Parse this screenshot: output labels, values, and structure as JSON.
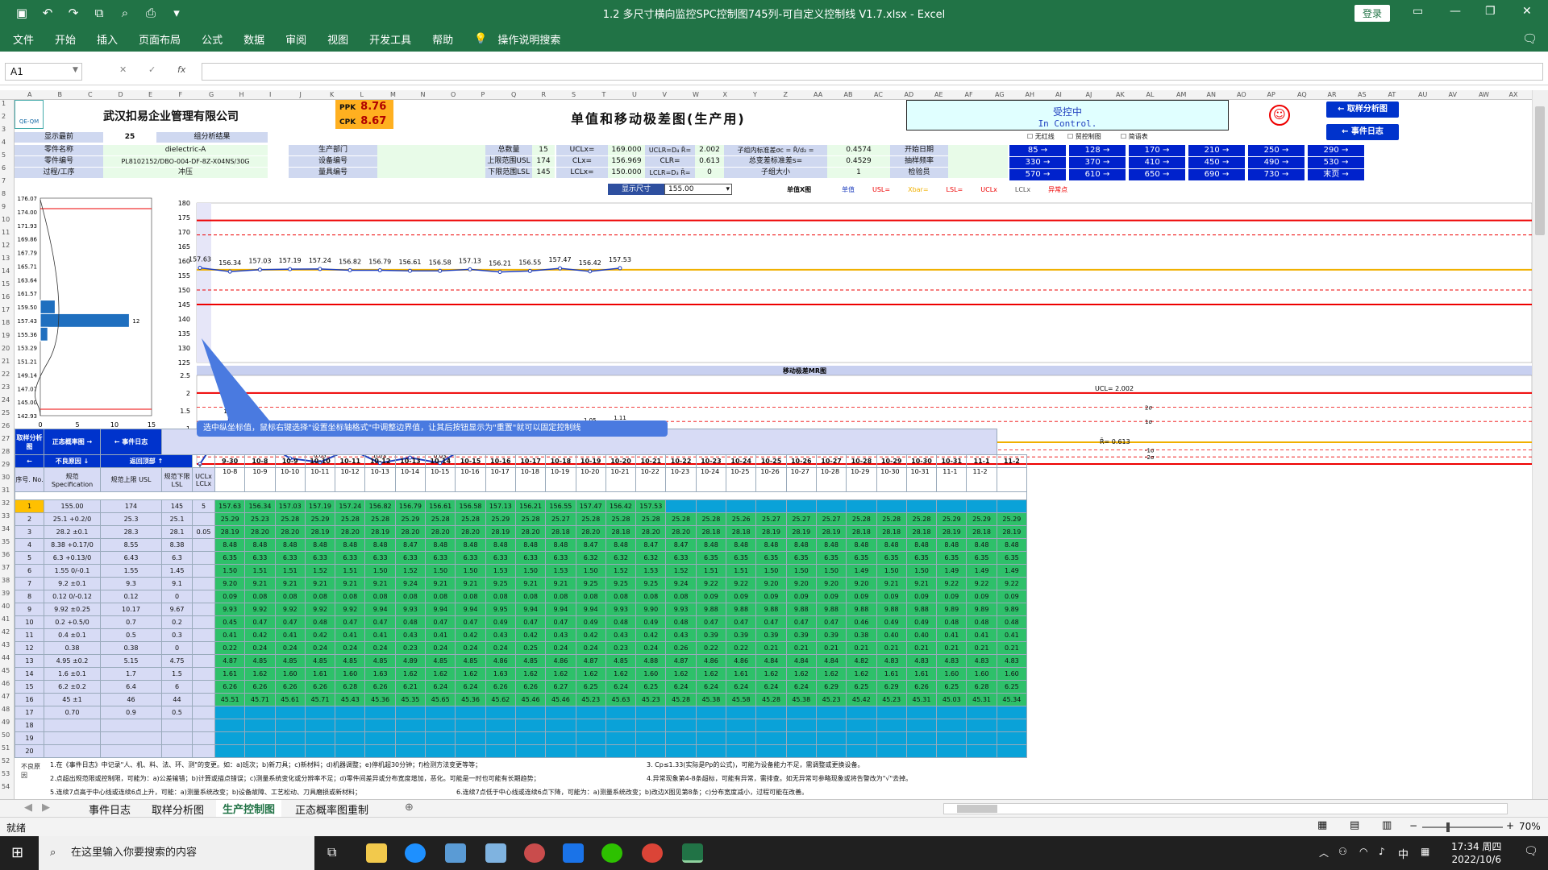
{
  "window": {
    "title": "1.2 多尺寸横向监控SPC控制图745列-可自定义控制线 V1.7.xlsx  -  Excel",
    "login": "登录"
  },
  "ribbon": [
    "文件",
    "开始",
    "插入",
    "页面布局",
    "公式",
    "数据",
    "审阅",
    "视图",
    "开发工具",
    "帮助",
    "操作说明搜索"
  ],
  "formula": {
    "namebox": "A1",
    "fx_label": "fx",
    "value": ""
  },
  "columns": [
    "A",
    "B",
    "C",
    "D",
    "E",
    "F",
    "G",
    "H",
    "I",
    "J",
    "K",
    "L",
    "M",
    "N",
    "O",
    "P",
    "Q",
    "R",
    "S",
    "T",
    "U",
    "V",
    "W",
    "X",
    "Y",
    "Z",
    "AA",
    "AB",
    "AC",
    "AD",
    "AE",
    "AF",
    "AG",
    "AH",
    "AI",
    "AJ",
    "AK",
    "AL",
    "AM",
    "AN",
    "AO",
    "AP",
    "AQ",
    "AR",
    "AS",
    "AT",
    "AU",
    "AV",
    "AW",
    "AX"
  ],
  "header": {
    "logo": "QE-QM",
    "company": "武汉扣易企业管理有限公司",
    "chart_title": "单值和移动极差图(生产用)",
    "ppk_label": "PPK",
    "ppk": "8.76",
    "cpk_label": "CPK",
    "cpk": "8.67",
    "status_cn": "受控中",
    "status_en": "In Control.",
    "btn_sampling": "← 取样分析图",
    "btn_events": "← 事件日志",
    "checkboxes": [
      "无红线",
      "贸控制图",
      "简语表"
    ]
  },
  "info": {
    "display_recent_label": "显示最前",
    "display_recent": "25",
    "group_result_label": "组分析结果",
    "part_name_label": "零件名称",
    "part_name": "dielectric-A",
    "part_no_label": "零件编号",
    "part_no": "PL8102152/DBO-004-DF-8Z-X04NS/30G",
    "process_label": "过程/工序",
    "process": "冲压",
    "dept_label": "生产部门",
    "equip_label": "设备编号",
    "tool_label": "量具编号",
    "total_label": "总数量",
    "total": "15",
    "usl_label": "上限范围USL",
    "usl": "174",
    "lsl_label": "下限范围LSL",
    "lsl": "145",
    "ucl_label": "UCLx=",
    "ucl": "169.000",
    "cl_label": "CLx=",
    "cl": "156.969",
    "lcl_label": "LCLx=",
    "lcl": "150.000",
    "uclr_label": "UCLR=D₄ R̄=",
    "uclr": "2.002",
    "clr_label": "CLR=",
    "clr": "0.613",
    "lclr_label": "LCLR=D₃ R̄=",
    "lclr": "0",
    "sigma_in_label": "子组内标准差σc = R̄/d₂ =",
    "sigma_in": "0.4574",
    "sigma_tot_label": "总变差标准差s=",
    "sigma_tot": "0.4529",
    "subgroup_label": "子组大小",
    "subgroup": "1",
    "start_label": "开始日期",
    "freq_label": "抽样频率",
    "inspector_label": "检验员",
    "pages": [
      "85 →",
      "128 →",
      "170 →",
      "210 →",
      "250 →",
      "290 →",
      "330 →",
      "370 →",
      "410 →",
      "450 →",
      "490 →",
      "530 →",
      "570 →",
      "610 →",
      "650 →",
      "690 →",
      "730 →",
      "末页 →"
    ],
    "display_size_label": "显示尺寸",
    "display_size": "155.00"
  },
  "chart_data": [
    {
      "type": "histogram",
      "title": "",
      "bins": [
        "176.07",
        "174.00",
        "171.93",
        "169.86",
        "167.79",
        "165.71",
        "163.64",
        "161.57",
        "159.50",
        "157.43",
        "155.36",
        "153.29",
        "151.21",
        "149.14",
        "147.07",
        "145.00",
        "142.93"
      ],
      "counts": [
        0,
        0,
        0,
        0,
        0,
        0,
        0,
        0,
        2,
        12,
        1,
        0,
        0,
        0,
        0,
        0,
        0
      ],
      "xticks": [
        "0",
        "5",
        "10",
        "15"
      ],
      "count_label": "12"
    },
    {
      "type": "line",
      "title": "单值X图",
      "legend": [
        "单值",
        "USL=",
        "Xbar=",
        "LSL=",
        "UCLx",
        "LCLx",
        "异常点"
      ],
      "categories": [
        "9-30",
        "10-8",
        "10-9",
        "10-10",
        "10-11",
        "10-12",
        "10-13",
        "10-14",
        "10-15",
        "10-16",
        "10-17",
        "10-18",
        "10-19",
        "10-20",
        "10-21",
        "10-22",
        "10-23",
        "10-24",
        "10-25",
        "10-26",
        "10-27",
        "10-28",
        "10-29",
        "10-30",
        "10-31",
        "11-1",
        "11-2"
      ],
      "values": [
        157.63,
        156.34,
        157.03,
        157.19,
        157.24,
        156.82,
        156.79,
        156.61,
        156.58,
        157.13,
        156.21,
        156.55,
        157.47,
        156.42,
        157.53
      ],
      "yticks": [
        "180",
        "175",
        "170",
        "165",
        "160",
        "155",
        "150",
        "145",
        "140",
        "135",
        "130",
        "125"
      ],
      "ylim": [
        125,
        180
      ],
      "usl": 174,
      "lsl": 145,
      "ucl": 169,
      "cl": 156.969,
      "lcl": 150
    },
    {
      "type": "line",
      "title": "移动极差MR图",
      "categories": [
        "9-30",
        "10-8",
        "10-9",
        "10-10",
        "10-11",
        "10-12",
        "10-13",
        "10-14",
        "10-15",
        "10-16",
        "10-17",
        "10-18",
        "10-19",
        "10-20",
        "10-21",
        "10-22",
        "10-23",
        "10-24",
        "10-25",
        "10-26",
        "10-27",
        "10-28",
        "10-29",
        "10-30",
        "10-31",
        "11-1",
        "11-2"
      ],
      "values": [
        0,
        1.29,
        0.69,
        0.16,
        0.05,
        0.42,
        0.03,
        0.18,
        0.03,
        0.55,
        0.92,
        0.34,
        0.92,
        1.05,
        1.11
      ],
      "yticks": [
        "2.5",
        "2",
        "1.5",
        "1",
        "0.5",
        "0"
      ],
      "ylim": [
        0,
        2.5
      ],
      "ucl": 2.002,
      "cl": 0.613,
      "ucl_label": "UCL= 2.002",
      "cl_label": "R̄= 0.613",
      "zone_labels": [
        "2σ",
        "1σ",
        "-1σ",
        "-2σ"
      ]
    }
  ],
  "tooltip": "选中纵坐标值，鼠标右键选择\"设置坐标轴格式\"中调整边界值，让其后按钮显示为\"重置\"就可以固定控制线",
  "table": {
    "left_btns": [
      "取样分析图",
      "正态概率图 →",
      "← 事件日志",
      "←",
      "不良原因 ↓",
      "返回顶部 ↑"
    ],
    "hdr": [
      "序号. No.",
      "规范 Specification",
      "规范上限 USL",
      "规范下限 LSL",
      "UCLx LCLx"
    ],
    "dates": [
      "9-30",
      "10-8",
      "10-9",
      "10-10",
      "10-11",
      "10-12",
      "10-13",
      "10-14",
      "10-15",
      "10-16",
      "10-17",
      "10-18",
      "10-19",
      "10-20",
      "10-21",
      "10-22",
      "10-23",
      "10-24",
      "10-25",
      "10-26",
      "10-27",
      "10-28",
      "10-29",
      "10-30",
      "10-31",
      "11-1",
      "11-2"
    ],
    "rows": [
      {
        "no": "1",
        "spec": "155.00",
        "usl": "174",
        "lsl": "145",
        "ctl": "5",
        "v": [
          "157.63",
          "156.34",
          "157.03",
          "157.19",
          "157.24",
          "156.82",
          "156.79",
          "156.61",
          "156.58",
          "157.13",
          "156.21",
          "156.55",
          "157.47",
          "156.42",
          "157.53"
        ]
      },
      {
        "no": "2",
        "spec": "25.1 +0.2/0",
        "usl": "25.3",
        "lsl": "25.1",
        "ctl": "",
        "v": [
          "25.29",
          "25.23",
          "25.28",
          "25.29",
          "25.28",
          "25.28",
          "25.29",
          "25.28",
          "25.28",
          "25.29",
          "25.28",
          "25.27",
          "25.28",
          "25.28",
          "25.28",
          "25.28",
          "25.28",
          "25.26",
          "25.27",
          "25.27",
          "25.27",
          "25.28",
          "25.28",
          "25.28",
          "25.29",
          "25.29",
          "25.29"
        ]
      },
      {
        "no": "3",
        "spec": "28.2 ±0.1",
        "usl": "28.3",
        "lsl": "28.1",
        "ctl": "0.05",
        "v": [
          "28.19",
          "28.20",
          "28.20",
          "28.19",
          "28.20",
          "28.19",
          "28.20",
          "28.20",
          "28.20",
          "28.19",
          "28.20",
          "28.18",
          "28.20",
          "28.18",
          "28.20",
          "28.20",
          "28.18",
          "28.18",
          "28.19",
          "28.19",
          "28.19",
          "28.18",
          "28.18",
          "28.18",
          "28.19",
          "28.18",
          "28.19"
        ]
      },
      {
        "no": "4",
        "spec": "8.38 +0.17/0",
        "usl": "8.55",
        "lsl": "8.38",
        "ctl": "",
        "v": [
          "8.48",
          "8.48",
          "8.48",
          "8.48",
          "8.48",
          "8.48",
          "8.47",
          "8.48",
          "8.48",
          "8.48",
          "8.48",
          "8.48",
          "8.47",
          "8.48",
          "8.47",
          "8.47",
          "8.48",
          "8.48",
          "8.48",
          "8.48",
          "8.48",
          "8.48",
          "8.48",
          "8.48",
          "8.48",
          "8.48",
          "8.48"
        ]
      },
      {
        "no": "5",
        "spec": "6.3 +0.13/0",
        "usl": "6.43",
        "lsl": "6.3",
        "ctl": "",
        "v": [
          "6.35",
          "6.33",
          "6.33",
          "6.33",
          "6.33",
          "6.33",
          "6.33",
          "6.33",
          "6.33",
          "6.33",
          "6.33",
          "6.33",
          "6.32",
          "6.32",
          "6.32",
          "6.33",
          "6.35",
          "6.35",
          "6.35",
          "6.35",
          "6.35",
          "6.35",
          "6.35",
          "6.35",
          "6.35",
          "6.35",
          "6.35"
        ]
      },
      {
        "no": "6",
        "spec": "1.55 0/-0.1",
        "usl": "1.55",
        "lsl": "1.45",
        "ctl": "",
        "v": [
          "1.50",
          "1.51",
          "1.51",
          "1.52",
          "1.51",
          "1.50",
          "1.52",
          "1.50",
          "1.50",
          "1.53",
          "1.50",
          "1.53",
          "1.50",
          "1.52",
          "1.53",
          "1.52",
          "1.51",
          "1.51",
          "1.50",
          "1.50",
          "1.50",
          "1.49",
          "1.50",
          "1.50",
          "1.49",
          "1.49",
          "1.49"
        ]
      },
      {
        "no": "7",
        "spec": "9.2 ±0.1",
        "usl": "9.3",
        "lsl": "9.1",
        "ctl": "",
        "v": [
          "9.20",
          "9.21",
          "9.21",
          "9.21",
          "9.21",
          "9.21",
          "9.24",
          "9.21",
          "9.21",
          "9.25",
          "9.21",
          "9.21",
          "9.25",
          "9.25",
          "9.25",
          "9.24",
          "9.22",
          "9.22",
          "9.20",
          "9.20",
          "9.20",
          "9.20",
          "9.21",
          "9.21",
          "9.22",
          "9.22",
          "9.22"
        ]
      },
      {
        "no": "8",
        "spec": "0.12 0/-0.12",
        "usl": "0.12",
        "lsl": "0",
        "ctl": "",
        "v": [
          "0.09",
          "0.08",
          "0.08",
          "0.08",
          "0.08",
          "0.08",
          "0.08",
          "0.08",
          "0.08",
          "0.08",
          "0.08",
          "0.08",
          "0.08",
          "0.08",
          "0.08",
          "0.08",
          "0.09",
          "0.09",
          "0.09",
          "0.09",
          "0.09",
          "0.09",
          "0.09",
          "0.09",
          "0.09",
          "0.09",
          "0.09"
        ]
      },
      {
        "no": "9",
        "spec": "9.92 ±0.25",
        "usl": "10.17",
        "lsl": "9.67",
        "ctl": "",
        "v": [
          "9.93",
          "9.92",
          "9.92",
          "9.92",
          "9.92",
          "9.94",
          "9.93",
          "9.94",
          "9.94",
          "9.95",
          "9.94",
          "9.94",
          "9.94",
          "9.93",
          "9.90",
          "9.93",
          "9.88",
          "9.88",
          "9.88",
          "9.88",
          "9.88",
          "9.88",
          "9.88",
          "9.88",
          "9.89",
          "9.89",
          "9.89"
        ]
      },
      {
        "no": "10",
        "spec": "0.2 +0.5/0",
        "usl": "0.7",
        "lsl": "0.2",
        "ctl": "",
        "v": [
          "0.45",
          "0.47",
          "0.47",
          "0.48",
          "0.47",
          "0.47",
          "0.48",
          "0.47",
          "0.47",
          "0.49",
          "0.47",
          "0.47",
          "0.49",
          "0.48",
          "0.49",
          "0.48",
          "0.47",
          "0.47",
          "0.47",
          "0.47",
          "0.47",
          "0.46",
          "0.49",
          "0.49",
          "0.48",
          "0.48",
          "0.48"
        ]
      },
      {
        "no": "11",
        "spec": "0.4 ±0.1",
        "usl": "0.5",
        "lsl": "0.3",
        "ctl": "",
        "v": [
          "0.41",
          "0.42",
          "0.41",
          "0.42",
          "0.41",
          "0.41",
          "0.43",
          "0.41",
          "0.42",
          "0.43",
          "0.42",
          "0.43",
          "0.42",
          "0.43",
          "0.42",
          "0.43",
          "0.39",
          "0.39",
          "0.39",
          "0.39",
          "0.39",
          "0.38",
          "0.40",
          "0.40",
          "0.41",
          "0.41",
          "0.41"
        ]
      },
      {
        "no": "12",
        "spec": "0.38",
        "usl": "0.38",
        "lsl": "0",
        "ctl": "",
        "v": [
          "0.22",
          "0.24",
          "0.24",
          "0.24",
          "0.24",
          "0.24",
          "0.23",
          "0.24",
          "0.24",
          "0.24",
          "0.25",
          "0.24",
          "0.24",
          "0.23",
          "0.24",
          "0.26",
          "0.22",
          "0.22",
          "0.21",
          "0.21",
          "0.21",
          "0.21",
          "0.21",
          "0.21",
          "0.21",
          "0.21",
          "0.21"
        ]
      },
      {
        "no": "13",
        "spec": "4.95 ±0.2",
        "usl": "5.15",
        "lsl": "4.75",
        "ctl": "",
        "v": [
          "4.87",
          "4.85",
          "4.85",
          "4.85",
          "4.85",
          "4.85",
          "4.89",
          "4.85",
          "4.85",
          "4.86",
          "4.85",
          "4.86",
          "4.87",
          "4.85",
          "4.88",
          "4.87",
          "4.86",
          "4.86",
          "4.84",
          "4.84",
          "4.84",
          "4.82",
          "4.83",
          "4.83",
          "4.83",
          "4.83",
          "4.83"
        ]
      },
      {
        "no": "14",
        "spec": "1.6 ±0.1",
        "usl": "1.7",
        "lsl": "1.5",
        "ctl": "",
        "v": [
          "1.61",
          "1.62",
          "1.60",
          "1.61",
          "1.60",
          "1.63",
          "1.62",
          "1.62",
          "1.62",
          "1.63",
          "1.62",
          "1.62",
          "1.62",
          "1.62",
          "1.60",
          "1.62",
          "1.62",
          "1.61",
          "1.62",
          "1.62",
          "1.62",
          "1.62",
          "1.61",
          "1.61",
          "1.60",
          "1.60",
          "1.60"
        ]
      },
      {
        "no": "15",
        "spec": "6.2 ±0.2",
        "usl": "6.4",
        "lsl": "6",
        "ctl": "",
        "v": [
          "6.26",
          "6.26",
          "6.26",
          "6.26",
          "6.28",
          "6.26",
          "6.21",
          "6.24",
          "6.24",
          "6.26",
          "6.26",
          "6.27",
          "6.25",
          "6.24",
          "6.25",
          "6.24",
          "6.24",
          "6.24",
          "6.24",
          "6.24",
          "6.29",
          "6.25",
          "6.29",
          "6.26",
          "6.25",
          "6.28",
          "6.25"
        ]
      },
      {
        "no": "16",
        "spec": "45 ±1",
        "usl": "46",
        "lsl": "44",
        "ctl": "",
        "v": [
          "45.51",
          "45.71",
          "45.61",
          "45.71",
          "45.43",
          "45.36",
          "45.35",
          "45.65",
          "45.36",
          "45.62",
          "45.46",
          "45.46",
          "45.23",
          "45.63",
          "45.23",
          "45.28",
          "45.38",
          "45.58",
          "45.28",
          "45.38",
          "45.23",
          "45.42",
          "45.23",
          "45.31",
          "45.03",
          "45.31",
          "45.34"
        ]
      },
      {
        "no": "17",
        "spec": "0.70",
        "usl": "0.9",
        "lsl": "0.5",
        "ctl": "",
        "v": []
      },
      {
        "no": "18",
        "spec": "",
        "usl": "",
        "lsl": "",
        "ctl": "",
        "v": []
      },
      {
        "no": "19",
        "spec": "",
        "usl": "",
        "lsl": "",
        "ctl": "",
        "v": []
      },
      {
        "no": "20",
        "spec": "",
        "usl": "",
        "lsl": "",
        "ctl": "",
        "v": []
      }
    ]
  },
  "notes": {
    "reason_label": "不良原因",
    "n1": "1.在《事件日志》中记录\"人、机、料、法、环、测\"的变更。如：a)班次；b)新刀具；c)新材料；d)机器调整；e)停机超30分钟；f)检测方法变更等等；",
    "n2": "2.点超出规范限或控制限，可能为：a)公差输错；b)计算或描点错误；c)测量系统变化或分辨率不足；d)零件间差异或分布宽度增加，恶化。可能是一时也可能有长期趋势；",
    "n3": "5.连续7点高于中心线或连续6点上升，可能：a)测量系统改变；b)设备故障、工艺松动、刀具磨损或新材料；",
    "n4": "3. Cp≤1.33(实际是Pp的公式)，可能为设备能力不足，需调整或更换设备。",
    "n5": "4.异常现象第4-8条超标，可能有异常，需排查。如无异常可参略现象或将告警改为\"√\"去掉。",
    "n6": "6.连续7点低于中心线或连续6点下降，可能为：a)测量系统改变；b)改边X图见第8条；c)分布宽度减小，过程可能在改善。"
  },
  "sheet_tabs": [
    "事件日志",
    "取样分析图",
    "生产控制图",
    "正态概率图重制"
  ],
  "status": {
    "ready": "就绪",
    "zoom": "70%"
  },
  "taskbar": {
    "search": "在这里输入你要搜索的内容",
    "time": "17:34 周四",
    "date": "2022/10/6",
    "ime": "中"
  }
}
